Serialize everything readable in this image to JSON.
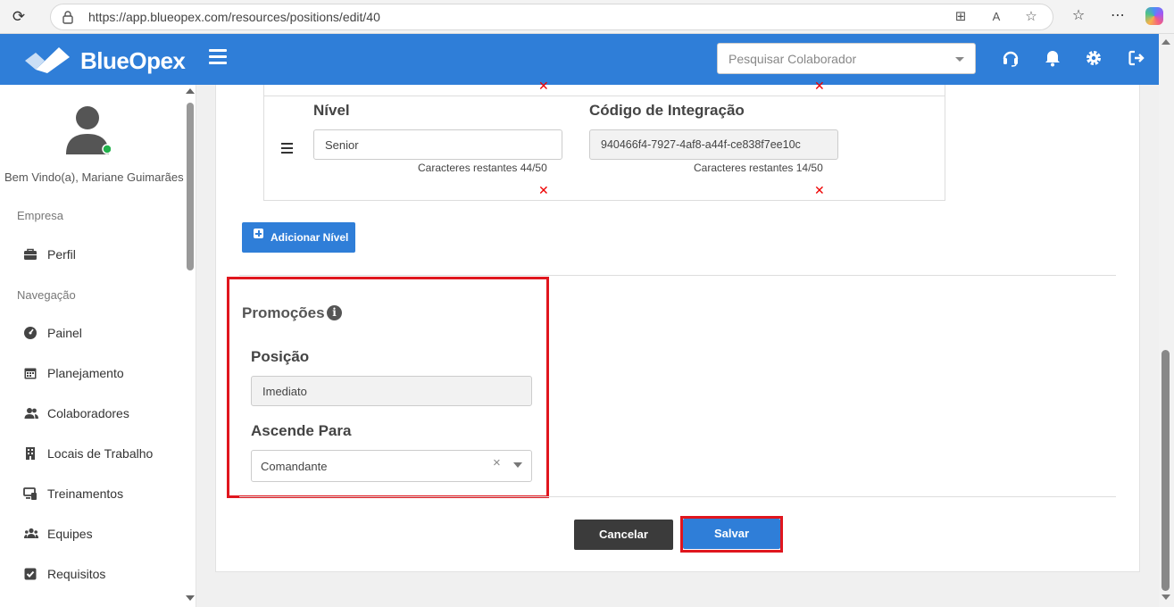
{
  "browser": {
    "url": "https://app.blueopex.com/resources/positions/edit/40"
  },
  "app": {
    "brand": "BlueOpex",
    "search_placeholder": "Pesquisar Colaborador",
    "colors": {
      "primary": "#2f7ed8",
      "highlight": "#e0161e",
      "dark_button": "#3b3b3b"
    }
  },
  "sidebar": {
    "welcome": "Bem Vindo(a), Mariane Guimarães",
    "section_company": "Empresa",
    "section_nav": "Navegação",
    "items": [
      {
        "label": "Perfil",
        "icon": "briefcase-icon"
      },
      {
        "label": "Painel",
        "icon": "dashboard-icon"
      },
      {
        "label": "Planejamento",
        "icon": "calendar-icon"
      },
      {
        "label": "Colaboradores",
        "icon": "users-icon"
      },
      {
        "label": "Locais de Trabalho",
        "icon": "building-icon"
      },
      {
        "label": "Treinamentos",
        "icon": "training-icon"
      },
      {
        "label": "Equipes",
        "icon": "team-icon"
      },
      {
        "label": "Requisitos",
        "icon": "checkbox-icon"
      }
    ]
  },
  "level": {
    "nivel_label": "Nível",
    "nivel_value": "Senior",
    "nivel_counter": "Caracteres restantes 44/50",
    "code_label": "Código de Integração",
    "code_value": "940466f4-7927-4af8-a44f-ce838f7ee10c",
    "code_counter": "Caracteres restantes 14/50",
    "remove_glyph": "✕"
  },
  "add_level_label": "Adicionar Nível",
  "promotions": {
    "title": "Promoções",
    "info_glyph": "i",
    "position_label": "Posição",
    "position_value": "Imediato",
    "ascends_label": "Ascende Para",
    "ascends_value": "Comandante",
    "clear_glyph": "×"
  },
  "actions": {
    "cancel": "Cancelar",
    "save": "Salvar"
  }
}
